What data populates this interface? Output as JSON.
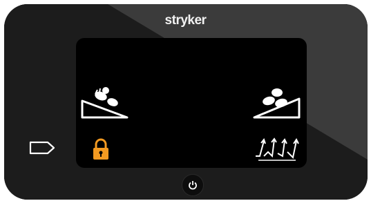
{
  "brand": {
    "name": "stryker"
  },
  "screen": {
    "left_controls": [
      {
        "icon": "head-of-bed-down-icon",
        "action": "lower-head-of-bed"
      },
      {
        "icon": "lock-icon",
        "state": "locked",
        "color": "#f39a21"
      }
    ],
    "right_controls": [
      {
        "icon": "head-of-bed-up-icon",
        "action": "raise-head-of-bed"
      },
      {
        "icon": "bed-exit-arrows-icon",
        "action": "bed-exit"
      }
    ]
  },
  "hardware": {
    "side_button_icon": "tag-outline-icon",
    "power_button_icon": "power-icon"
  },
  "colors": {
    "accent": "#f39a21",
    "bezel_dark": "#1b1b1b",
    "bezel_light": "#3c3c3c",
    "screen": "#000000",
    "icon": "#ffffff"
  }
}
